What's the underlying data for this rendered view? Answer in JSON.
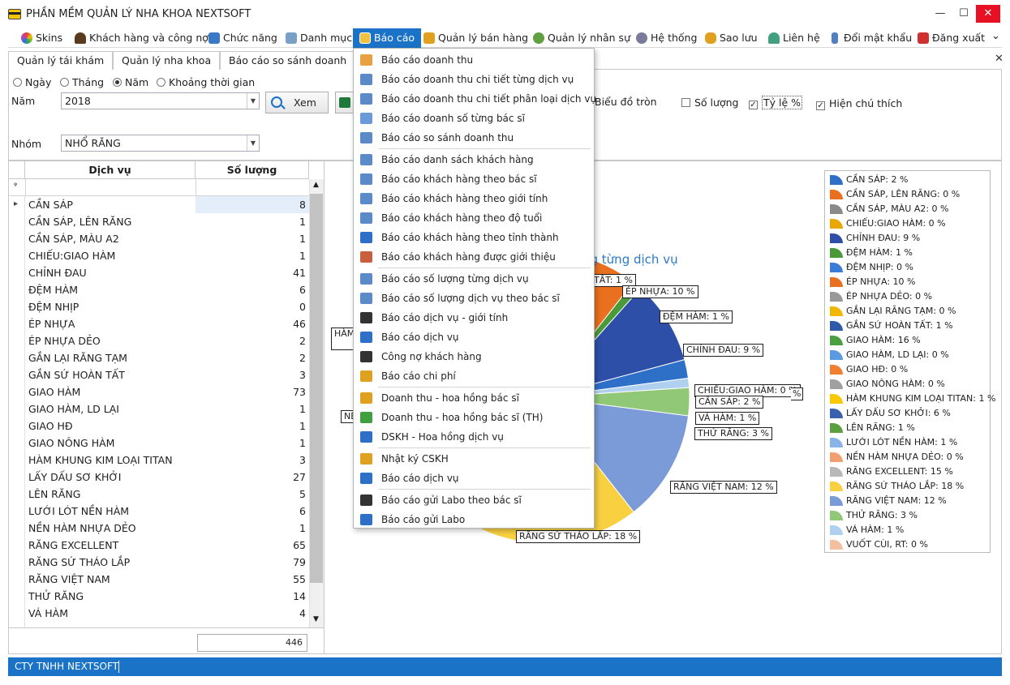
{
  "window": {
    "title": "PHẦN MỀM QUẢN LÝ NHA KHOA NEXTSOFT",
    "minimize": "—",
    "maximize": "☐",
    "close": "✕"
  },
  "menu": [
    {
      "label": "Skins",
      "color": "#e04a8a"
    },
    {
      "label": "Khách hàng và công nợ",
      "color": "#5a3b20"
    },
    {
      "label": "Chức năng",
      "color": "#3a78c8"
    },
    {
      "label": "Danh mục",
      "color": "#7aa0c8"
    },
    {
      "label": "Báo cáo",
      "color": "#f0c040"
    },
    {
      "label": "Quản lý bán hàng",
      "color": "#e0a020"
    },
    {
      "label": "Quản lý nhân sự",
      "color": "#60a040"
    },
    {
      "label": "Hệ thống",
      "color": "#7a7a9a"
    },
    {
      "label": "Sao lưu",
      "color": "#e0a020"
    },
    {
      "label": "Liên hệ",
      "color": "#40a080"
    },
    {
      "label": "Đổi mật khẩu",
      "color": "#5080c0"
    },
    {
      "label": "Đăng xuất",
      "color": "#d03030"
    }
  ],
  "menu_more": "⌄",
  "tabs": [
    "Quản lý tái khám",
    "Quản lý nha khoa",
    "Báo cáo so sánh doanh"
  ],
  "tabs_close": "✕",
  "filters": {
    "period_options": [
      "Ngày",
      "Tháng",
      "Năm",
      "Khoảng thời gian"
    ],
    "selected_period": "Năm",
    "year_label": "Năm",
    "year_value": "2018",
    "view_button": "Xem",
    "group_label": "Nhóm",
    "group_value": "NHỔ RĂNG",
    "pie_label": "Biểu đồ tròn",
    "qty_label": "Số lượng",
    "ratio_label": "Tỷ lệ %",
    "legend_label": "Hiện chú thích",
    "qty_checked": false,
    "ratio_checked": true,
    "legend_checked": true
  },
  "grid": {
    "headers": [
      "Dịch vụ",
      "Số lượng"
    ],
    "filter_icon": "ᵠ",
    "current_row_marker": "▸",
    "rows": [
      [
        "CẦN SÁP",
        "8"
      ],
      [
        "CẦN SÁP, LÊN RĂNG",
        "1"
      ],
      [
        "CẦN SÁP, MÀU A2",
        "1"
      ],
      [
        "CHIẾU:GIAO HÀM",
        "1"
      ],
      [
        "CHỈNH ĐAU",
        "41"
      ],
      [
        "ĐỆM HÀM",
        "6"
      ],
      [
        "ĐỆM NHỊP",
        "0"
      ],
      [
        "ÉP NHỰA",
        "46"
      ],
      [
        "ÉP NHỰA DẺO",
        "2"
      ],
      [
        "GẮN LẠI RĂNG TẠM",
        "2"
      ],
      [
        "GẮN SỨ HOÀN TẤT",
        "3"
      ],
      [
        "GIAO HÀM",
        "73"
      ],
      [
        "GIAO HÀM, LD LẠI",
        "1"
      ],
      [
        "GIAO HĐ",
        "1"
      ],
      [
        "GIAO NÔNG HÀM",
        "1"
      ],
      [
        "HÀM KHUNG KIM LOẠI TITAN",
        "3"
      ],
      [
        "LẤY DẤU SƠ KHỞI",
        "27"
      ],
      [
        "LÊN RĂNG",
        "5"
      ],
      [
        "LƯỚI LÓT NỀN HÀM",
        "6"
      ],
      [
        "NỀN HÀM NHỰA DẺO",
        "1"
      ],
      [
        "RĂNG EXCELLENT",
        "65"
      ],
      [
        "RĂNG SỨ THÁO LẮP",
        "79"
      ],
      [
        "RĂNG VIỆT NAM",
        "55"
      ],
      [
        "THỬ RĂNG",
        "14"
      ],
      [
        "VÁ HÀM",
        "4"
      ]
    ],
    "total": "446"
  },
  "chart": {
    "title_fragment": "ng từng dịch vụ",
    "labels": [
      {
        "text": "ÉP NHỰA: 10 %",
        "color": "#e87722"
      },
      {
        "text": "ĐỆM HÀM: 1 %",
        "color": "#4aa84a"
      },
      {
        "text": "CHỈNH ĐAU: 9 %",
        "color": "#2e5aa8"
      },
      {
        "text": "CHIẾU:GIAO HÀM: 0 %",
        "color": "#e0a800"
      },
      {
        "text": "CẦN SÁP: 2 %",
        "color": "#2e5aa8"
      },
      {
        "text": "VÁ HÀM: 1 %",
        "color": "#9ac0e8"
      },
      {
        "text": "THỬ RĂNG: 3 %",
        "color": "#7ab050"
      },
      {
        "text": "RĂNG VIỆT NAM: 12 %",
        "color": "#6a8cc8"
      },
      {
        "text": "RĂNG SỨ THÁO LẮP: 18 %",
        "color": "#e8b000"
      },
      {
        "text": "TẤT: 1 %",
        "color": "#2e5aa8"
      },
      {
        "text": "HÀM",
        "color": "#e0a800"
      },
      {
        "text": "NỀ",
        "color": "#e87722"
      },
      {
        "text": "%",
        "color": "#e87722"
      }
    ]
  },
  "chart_data": {
    "type": "pie",
    "title": "",
    "labels": [
      "CẦN SÁP",
      "CẦN SÁP, LÊN RĂNG",
      "CẦN SÁP, MÀU A2",
      "CHIẾU:GIAO HÀM",
      "CHỈNH ĐAU",
      "ĐỆM HÀM",
      "ĐỆM NHỊP",
      "ÉP NHỰA",
      "ÉP NHỰA DẺO",
      "GẮN LẠI RĂNG TẠM",
      "GẮN SỨ HOÀN TẤT",
      "GIAO HÀM",
      "GIAO HÀM, LD LẠI",
      "GIAO HĐ",
      "GIAO NÔNG HÀM",
      "HÀM KHUNG KIM LOẠI TITAN",
      "LẤY DẤU SƠ KHỞI",
      "LÊN RĂNG",
      "LƯỚI LÓT NỀN HÀM",
      "NỀN HÀM NHỰA DẺO",
      "RĂNG EXCELLENT",
      "RĂNG SỨ THÁO LẮP",
      "RĂNG VIỆT NAM",
      "THỬ RĂNG",
      "VÁ HÀM",
      "VUỐT CÙI, RT"
    ],
    "values": [
      2,
      0,
      0,
      0,
      9,
      1,
      0,
      10,
      0,
      0,
      1,
      16,
      0,
      0,
      0,
      1,
      6,
      1,
      1,
      0,
      15,
      18,
      12,
      3,
      1,
      0
    ],
    "legend": [
      {
        "text": "CẦN SÁP: 2 %",
        "color": "#2e6fc8"
      },
      {
        "text": "CẦN SÁP, LÊN RĂNG: 0 %",
        "color": "#e8701e"
      },
      {
        "text": "CẦN SÁP, MÀU A2: 0 %",
        "color": "#8a8a8a"
      },
      {
        "text": "CHIẾU:GIAO HÀM: 0 %",
        "color": "#e8a800"
      },
      {
        "text": "CHỈNH ĐAU: 9 %",
        "color": "#2e4fa8"
      },
      {
        "text": "ĐỆM HÀM: 1 %",
        "color": "#4a9a3a"
      },
      {
        "text": "ĐỆM NHỊP: 0 %",
        "color": "#3a7ad8"
      },
      {
        "text": "ÉP NHỰA: 10 %",
        "color": "#e8701e"
      },
      {
        "text": "ÉP NHỰA DẺO: 0 %",
        "color": "#999999"
      },
      {
        "text": "GẮN LẠI RĂNG TẠM: 0 %",
        "color": "#f0b800"
      },
      {
        "text": "GẮN SỨ HOÀN TẤT: 1 %",
        "color": "#2e5aa8"
      },
      {
        "text": "GIAO HÀM: 16 %",
        "color": "#4aa040"
      },
      {
        "text": "GIAO HÀM, LD LẠI: 0 %",
        "color": "#5a9ae0"
      },
      {
        "text": "GIAO HĐ: 0 %",
        "color": "#f08030"
      },
      {
        "text": "GIAO NÔNG HÀM: 0 %",
        "color": "#a0a0a0"
      },
      {
        "text": "HÀM KHUNG KIM LOẠI TITAN: 1 %",
        "color": "#f8c800"
      },
      {
        "text": "LẤY DẤU SƠ KHỞI: 6 %",
        "color": "#3a60b0"
      },
      {
        "text": "LÊN RĂNG: 1 %",
        "color": "#5aa040"
      },
      {
        "text": "LƯỚI LÓT NỀN HÀM: 1 %",
        "color": "#8ab4e8"
      },
      {
        "text": "NỀN HÀM NHỰA DẺO: 0 %",
        "color": "#f0a070"
      },
      {
        "text": "RĂNG EXCELLENT: 15 %",
        "color": "#b8b8b8"
      },
      {
        "text": "RĂNG SỨ THÁO LẮP: 18 %",
        "color": "#f8d040"
      },
      {
        "text": "RĂNG VIỆT NAM: 12 %",
        "color": "#7a9ad8"
      },
      {
        "text": "THỬ RĂNG: 3 %",
        "color": "#90c878"
      },
      {
        "text": "VÁ HÀM: 1 %",
        "color": "#b0d0f0"
      },
      {
        "text": "VUỐT CÙI, RT: 0 %",
        "color": "#f4c0a0"
      }
    ]
  },
  "dropdown": {
    "groups": [
      [
        {
          "label": "Báo cáo doanh thu",
          "icon": "report-revenue-icon",
          "color": "#e8a040"
        },
        {
          "label": "Báo cáo doanh thu chi tiết từng dịch vụ",
          "icon": "report-detail-icon",
          "color": "#5a8ac8"
        },
        {
          "label": "Báo cáo doanh thu chi tiết phân loại dịch vụ",
          "icon": "report-category-icon",
          "color": "#5a8ac8"
        },
        {
          "label": "Báo cáo doanh số từng bác sĩ",
          "icon": "report-doctor-icon",
          "color": "#6a9ad8"
        },
        {
          "label": "Báo cáo so sánh doanh thu",
          "icon": "report-compare-icon",
          "color": "#5a8ac8"
        }
      ],
      [
        {
          "label": "Báo cáo danh sách khách hàng",
          "icon": "customer-list-icon",
          "color": "#5a8ac8"
        },
        {
          "label": "Báo cáo khách hàng theo bác sĩ",
          "icon": "customer-doctor-icon",
          "color": "#5a8ac8"
        },
        {
          "label": "Báo cáo khách hàng theo giới tính",
          "icon": "customer-gender-icon",
          "color": "#5a8ac8"
        },
        {
          "label": "Báo cáo khách hàng theo độ tuổi",
          "icon": "customer-age-icon",
          "color": "#5a8ac8"
        },
        {
          "label": "Báo cáo khách hàng theo tỉnh thành",
          "icon": "customer-province-icon",
          "color": "#2e6fc8"
        },
        {
          "label": "Báo cáo khách hàng được giới thiệu",
          "icon": "customer-referral-icon",
          "color": "#c86040"
        }
      ],
      [
        {
          "label": "Báo cáo số lượng từng dịch vụ",
          "icon": "service-qty-icon",
          "color": "#5a8ac8"
        },
        {
          "label": "Báo cáo số lượng dịch vụ theo bác sĩ",
          "icon": "service-doctor-icon",
          "color": "#5a8ac8"
        },
        {
          "label": "Báo cáo dịch vụ - giới tính",
          "icon": "barcode-icon",
          "color": "#333333"
        },
        {
          "label": "Báo cáo dịch vụ",
          "icon": "book-icon",
          "color": "#2e6fc8"
        },
        {
          "label": "Công nợ khách hàng",
          "icon": "debt-icon",
          "color": "#333333"
        },
        {
          "label": "Báo cáo chi phí",
          "icon": "expense-icon",
          "color": "#e0a020"
        }
      ],
      [
        {
          "label": "Doanh thu - hoa hồng bác sĩ",
          "icon": "commission-icon",
          "color": "#e0a020"
        },
        {
          "label": "Doanh thu - hoa hồng bác sĩ (TH)",
          "icon": "commission-summary-icon",
          "color": "#40a040"
        },
        {
          "label": "DSKH - Hoa hồng dịch vụ",
          "icon": "service-commission-icon",
          "color": "#2e6fc8"
        }
      ],
      [
        {
          "label": "Nhật ký CSKH",
          "icon": "clipboard-icon",
          "color": "#e0a020"
        },
        {
          "label": "Báo cáo dịch vụ",
          "icon": "book-icon",
          "color": "#2e6fc8"
        }
      ],
      [
        {
          "label": "Báo cáo gửi Labo theo bác sĩ",
          "icon": "arrow-right-dark-icon",
          "color": "#333333"
        },
        {
          "label": "Báo cáo gửi Labo",
          "icon": "arrow-right-blue-icon",
          "color": "#2e6fc8"
        }
      ]
    ]
  },
  "status": {
    "company": "CTY TNHH NEXTSOFT"
  }
}
